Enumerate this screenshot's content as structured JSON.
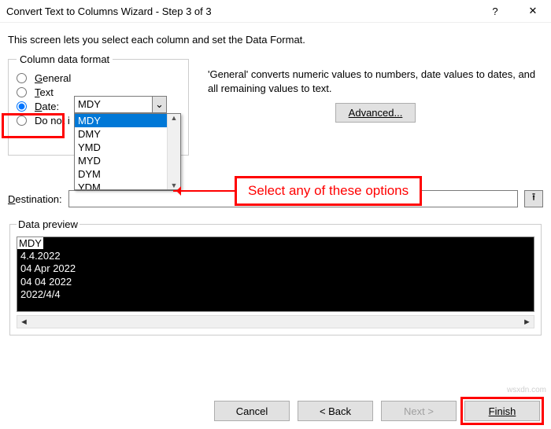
{
  "titlebar": {
    "title": "Convert Text to Columns Wizard - Step 3 of 3",
    "help": "?",
    "close": "✕"
  },
  "desc": "This screen lets you select each column and set the Data Format.",
  "format_group": {
    "legend": "Column data format",
    "general": "General",
    "text": "Text",
    "date": "Date:",
    "skip": "Do not i"
  },
  "combo": {
    "value": "MDY",
    "options": [
      "MDY",
      "DMY",
      "YMD",
      "MYD",
      "DYM",
      "YDM"
    ],
    "chevron": "⌄"
  },
  "explain": "'General' converts numeric values to numbers, date values to dates, and all remaining values to text.",
  "advanced_label": "Advanced...",
  "callout": "Select any of these options",
  "destination_label": "Destination:",
  "dest_icon": "⭱",
  "preview_legend": "Data preview",
  "preview": {
    "header": "MDY",
    "rows": [
      "4.4.2022",
      "04 Apr 2022",
      "04 04 2022",
      "2022/4/4"
    ]
  },
  "scroll": {
    "left": "◄",
    "right": "►",
    "up": "▲",
    "down": "▼"
  },
  "buttons": {
    "cancel": "Cancel",
    "back": "< Back",
    "next": "Next >",
    "finish": "Finish"
  },
  "watermark": "wsxdn.com"
}
